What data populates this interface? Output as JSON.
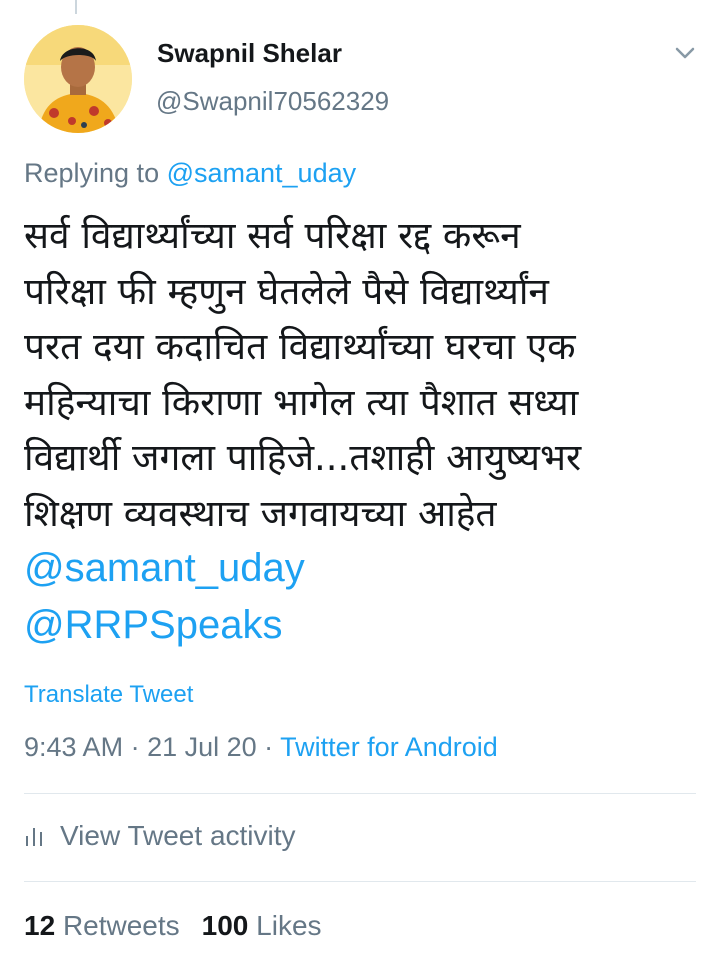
{
  "tweet": {
    "author_name": "Swapnil Shelar",
    "author_handle": "@Swapnil70562329",
    "replying_prefix": "Replying to ",
    "replying_to": "@samant_uday",
    "body_lines": [
      "सर्व विद्यार्थ्यांच्या सर्व परिक्षा रद्द करून",
      "परिक्षा फी म्हणुन घेतलेले पैसे विद्यार्थ्यांन",
      "परत दया कदाचित विद्यार्थ्यांच्या घरचा एक",
      "महिन्याचा किराणा भागेल त्या पैशात सध्या",
      "विद्यार्थी जगला पाहिजे...तशाही आयुष्यभर",
      "शिक्षण व्यवस्थाच जगवायच्या आहेत"
    ],
    "mentions": [
      "@samant_uday",
      "@RRPSpeaks"
    ],
    "translate_label": "Translate Tweet",
    "time": "9:43 AM",
    "date": "21 Jul 20",
    "separator": " · ",
    "source": "Twitter for Android",
    "activity_label": "View Tweet activity",
    "retweet_count": "12",
    "retweet_label": "Retweets",
    "like_count": "100",
    "like_label": "Likes"
  },
  "icons": {
    "caret": "chevron-down-icon",
    "activity": "bar-chart-icon",
    "avatar": "avatar"
  },
  "colors": {
    "link": "#1da1f2",
    "secondary_text": "#657786",
    "primary_text": "#14171a",
    "divider": "#e1e8ed"
  }
}
